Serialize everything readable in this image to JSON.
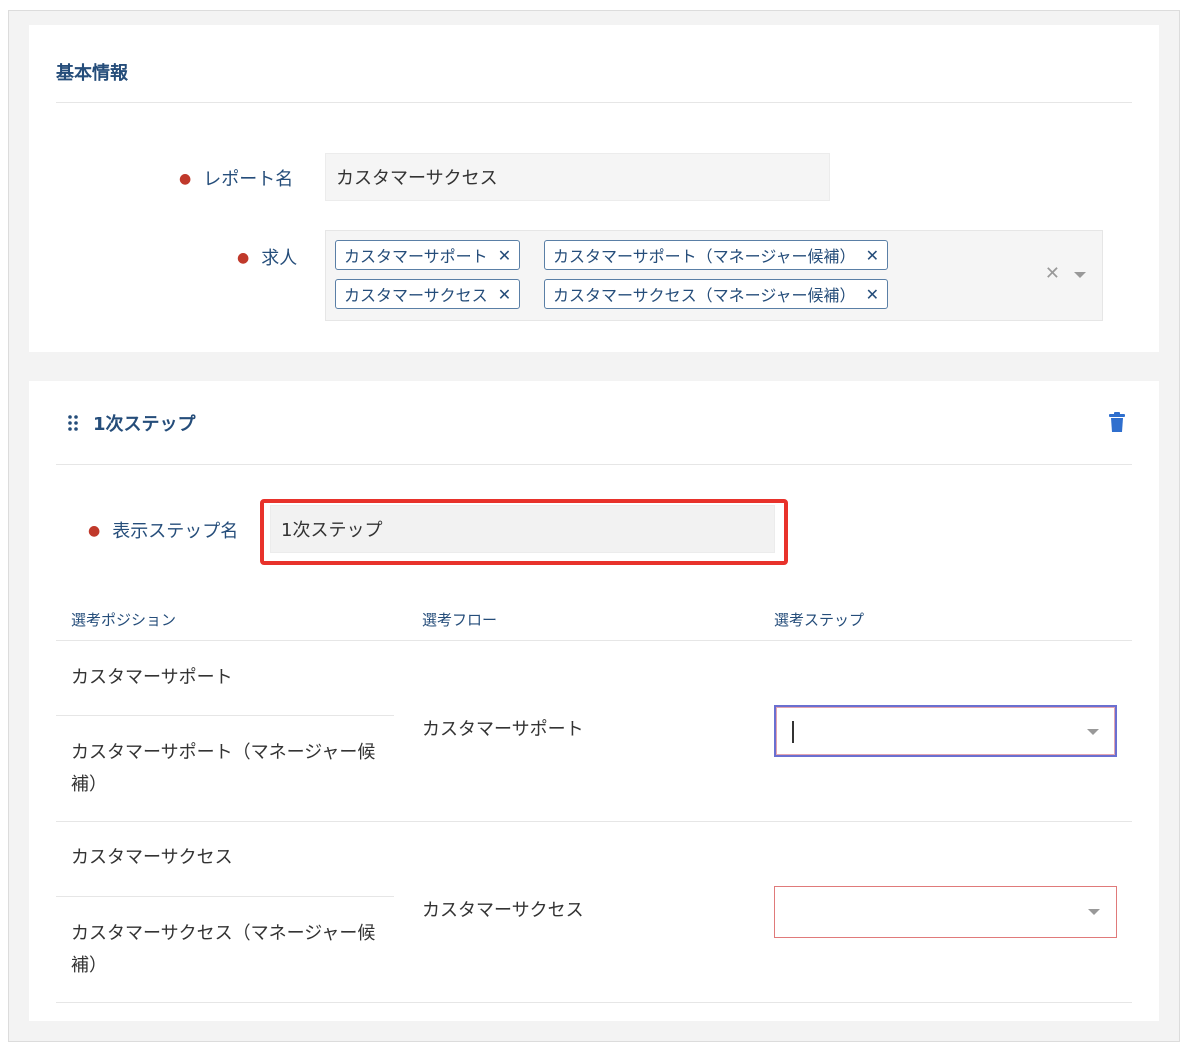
{
  "basic_info": {
    "title": "基本情報",
    "report_name_label": "レポート名",
    "report_name_value": "カスタマーサクセス",
    "jobs_label": "求人",
    "jobs_tags": [
      "カスタマーサポート",
      "カスタマーサポート（マネージャー候補）",
      "カスタマーサクセス",
      "カスタマーサクセス（マネージャー候補）"
    ],
    "tag_remove_glyph": "✕",
    "clear_all_glyph": "✕"
  },
  "step": {
    "title": "1次ステップ",
    "display_name_label": "表示ステップ名",
    "display_name_value": "1次ステップ",
    "columns": [
      "選考ポジション",
      "選考フロー",
      "選考ステップ"
    ],
    "groups": [
      {
        "positions": [
          "カスタマーサポート",
          "カスタマーサポート（マネージャー候補）"
        ],
        "flow": "カスタマーサポート",
        "step_value": ""
      },
      {
        "positions": [
          "カスタマーサクセス",
          "カスタマーサクセス（マネージャー候補）"
        ],
        "flow": "カスタマーサクセス",
        "step_value": ""
      }
    ]
  },
  "colors": {
    "accent": "#254d7a",
    "required": "#c0392b",
    "highlight": "#e8322b"
  },
  "icons": {
    "drag": "drag-handle-icon",
    "delete": "trash-icon",
    "caret": "chevron-down-icon"
  }
}
